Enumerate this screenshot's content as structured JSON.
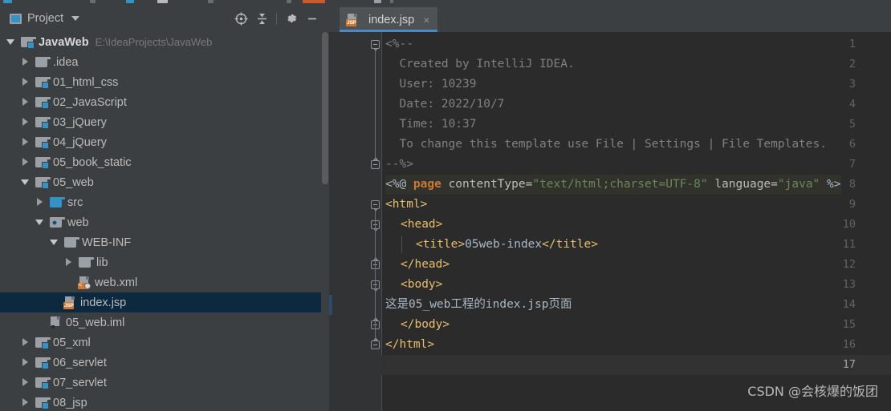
{
  "window": {
    "panel_title": "Project",
    "panel_icon": "project-window-icon",
    "header_actions": [
      {
        "name": "locate-icon",
        "label": "Select Opened File"
      },
      {
        "name": "collapse-all-icon",
        "label": "Collapse All"
      },
      {
        "name": "gear-icon",
        "label": "Settings"
      },
      {
        "name": "minimize-icon",
        "label": "Hide"
      }
    ]
  },
  "tree": {
    "items": [
      {
        "label": "JavaWeb",
        "path": "E:\\IdeaProjects\\JavaWeb",
        "indent": 0,
        "twisty": "down",
        "icon": "module-folder-icon",
        "bold": true,
        "selected": false
      },
      {
        "label": ".idea",
        "path": "",
        "indent": 1,
        "twisty": "right",
        "icon": "folder-icon",
        "bold": false,
        "selected": false
      },
      {
        "label": "01_html_css",
        "path": "",
        "indent": 1,
        "twisty": "right",
        "icon": "module-folder-icon",
        "bold": false,
        "selected": false
      },
      {
        "label": "02_JavaScript",
        "path": "",
        "indent": 1,
        "twisty": "right",
        "icon": "module-folder-icon",
        "bold": false,
        "selected": false
      },
      {
        "label": "03_jQuery",
        "path": "",
        "indent": 1,
        "twisty": "right",
        "icon": "module-folder-icon",
        "bold": false,
        "selected": false
      },
      {
        "label": "04_jQuery",
        "path": "",
        "indent": 1,
        "twisty": "right",
        "icon": "module-folder-icon",
        "bold": false,
        "selected": false
      },
      {
        "label": "05_book_static",
        "path": "",
        "indent": 1,
        "twisty": "right",
        "icon": "module-folder-icon",
        "bold": false,
        "selected": false
      },
      {
        "label": "05_web",
        "path": "",
        "indent": 1,
        "twisty": "down",
        "icon": "module-folder-icon",
        "bold": false,
        "selected": false
      },
      {
        "label": "src",
        "path": "",
        "indent": 2,
        "twisty": "right",
        "icon": "source-folder-icon",
        "bold": false,
        "selected": false
      },
      {
        "label": "web",
        "path": "",
        "indent": 2,
        "twisty": "down",
        "icon": "web-resource-folder-icon",
        "bold": false,
        "selected": false
      },
      {
        "label": "WEB-INF",
        "path": "",
        "indent": 3,
        "twisty": "down",
        "icon": "folder-icon",
        "bold": false,
        "selected": false
      },
      {
        "label": "lib",
        "path": "",
        "indent": 4,
        "twisty": "right",
        "icon": "folder-icon",
        "bold": false,
        "selected": false
      },
      {
        "label": "web.xml",
        "path": "",
        "indent": 4,
        "twisty": "none",
        "icon": "xml-file-icon",
        "bold": false,
        "selected": false
      },
      {
        "label": "index.jsp",
        "path": "",
        "indent": 3,
        "twisty": "none",
        "icon": "jsp-file-icon",
        "bold": false,
        "selected": true
      },
      {
        "label": "05_web.iml",
        "path": "",
        "indent": 2,
        "twisty": "none",
        "icon": "iml-file-icon",
        "bold": false,
        "selected": false
      },
      {
        "label": "05_xml",
        "path": "",
        "indent": 1,
        "twisty": "right",
        "icon": "module-folder-icon",
        "bold": false,
        "selected": false
      },
      {
        "label": "06_servlet",
        "path": "",
        "indent": 1,
        "twisty": "right",
        "icon": "module-folder-icon",
        "bold": false,
        "selected": false
      },
      {
        "label": "07_servlet",
        "path": "",
        "indent": 1,
        "twisty": "right",
        "icon": "module-folder-icon",
        "bold": false,
        "selected": false
      },
      {
        "label": "08_jsp",
        "path": "",
        "indent": 1,
        "twisty": "right",
        "icon": "module-folder-icon",
        "bold": false,
        "selected": false
      }
    ]
  },
  "editor": {
    "tab": {
      "name": "index.jsp",
      "icon": "jsp-file-icon",
      "close": "×",
      "active": true
    },
    "current_line": 17,
    "total_lines": 17,
    "line_numbers": [
      "1",
      "2",
      "3",
      "4",
      "5",
      "6",
      "7",
      "8",
      "9",
      "10",
      "11",
      "12",
      "13",
      "14",
      "15",
      "16",
      "17"
    ],
    "vcs_changed_lines": [
      14
    ],
    "lines": [
      {
        "n": 1,
        "segments": [
          {
            "t": "<%--",
            "c": "cm"
          }
        ],
        "indent": 0,
        "fold": "start"
      },
      {
        "n": 2,
        "segments": [
          {
            "t": "  Created by IntelliJ IDEA.",
            "c": "cm"
          }
        ],
        "indent": 0,
        "fold": "none"
      },
      {
        "n": 3,
        "segments": [
          {
            "t": "  User: 10239",
            "c": "cm"
          }
        ],
        "indent": 0,
        "fold": "none"
      },
      {
        "n": 4,
        "segments": [
          {
            "t": "  Date: 2022/10/7",
            "c": "cm"
          }
        ],
        "indent": 0,
        "fold": "none"
      },
      {
        "n": 5,
        "segments": [
          {
            "t": "  Time: 10:37",
            "c": "cm"
          }
        ],
        "indent": 0,
        "fold": "none"
      },
      {
        "n": 6,
        "segments": [
          {
            "t": "  To change this template use File | Settings | File Templates.",
            "c": "cm"
          }
        ],
        "indent": 0,
        "fold": "none"
      },
      {
        "n": 7,
        "segments": [
          {
            "t": "--%>",
            "c": "cm"
          }
        ],
        "indent": 0,
        "fold": "end"
      },
      {
        "n": 8,
        "segments": [
          {
            "t": "<%@ ",
            "c": "txt"
          },
          {
            "t": "page",
            "c": "kw"
          },
          {
            "t": " contentType=",
            "c": "attr"
          },
          {
            "t": "\"text/html;charset=UTF-8\"",
            "c": "str"
          },
          {
            "t": " language=",
            "c": "attr"
          },
          {
            "t": "\"java\"",
            "c": "str"
          },
          {
            "t": " %>",
            "c": "txt"
          }
        ],
        "indent": 0,
        "fold": "none",
        "highlight": true
      },
      {
        "n": 9,
        "segments": [
          {
            "t": "<html>",
            "c": "tag"
          }
        ],
        "indent": 0,
        "fold": "start"
      },
      {
        "n": 10,
        "segments": [
          {
            "t": "<head>",
            "c": "tag"
          }
        ],
        "indent": 1,
        "fold": "start"
      },
      {
        "n": 11,
        "segments": [
          {
            "t": "<title>",
            "c": "tag"
          },
          {
            "t": "05web-index",
            "c": "txt"
          },
          {
            "t": "</title>",
            "c": "tag"
          }
        ],
        "indent": 2,
        "fold": "none"
      },
      {
        "n": 12,
        "segments": [
          {
            "t": "</head>",
            "c": "tag"
          }
        ],
        "indent": 1,
        "fold": "end"
      },
      {
        "n": 13,
        "segments": [
          {
            "t": "<body>",
            "c": "tag"
          }
        ],
        "indent": 1,
        "fold": "start"
      },
      {
        "n": 14,
        "segments": [
          {
            "t": "这是05_web工程的index.jsp页面",
            "c": "txt"
          }
        ],
        "indent": 0,
        "fold": "none"
      },
      {
        "n": 15,
        "segments": [
          {
            "t": "</body>",
            "c": "tag"
          }
        ],
        "indent": 1,
        "fold": "end"
      },
      {
        "n": 16,
        "segments": [
          {
            "t": "</html>",
            "c": "tag"
          }
        ],
        "indent": 0,
        "fold": "end"
      },
      {
        "n": 17,
        "segments": [
          {
            "t": "",
            "c": "txt"
          }
        ],
        "indent": 0,
        "fold": "none"
      }
    ]
  },
  "watermark": {
    "text": "CSDN @会核爆的饭团"
  },
  "colors": {
    "panel_bg": "#3c3f41",
    "editor_bg": "#2b2b2b",
    "gutter_bg": "#313335",
    "selection_bg": "#0d293f",
    "tab_active_underline": "#4a88c7",
    "accent_blue": "#3592c4",
    "keyword_orange": "#cc7832",
    "string_green": "#6a8759",
    "tag_gold": "#e8bf6a",
    "text_grey": "#a9b7c6",
    "comment_grey": "#808080"
  }
}
